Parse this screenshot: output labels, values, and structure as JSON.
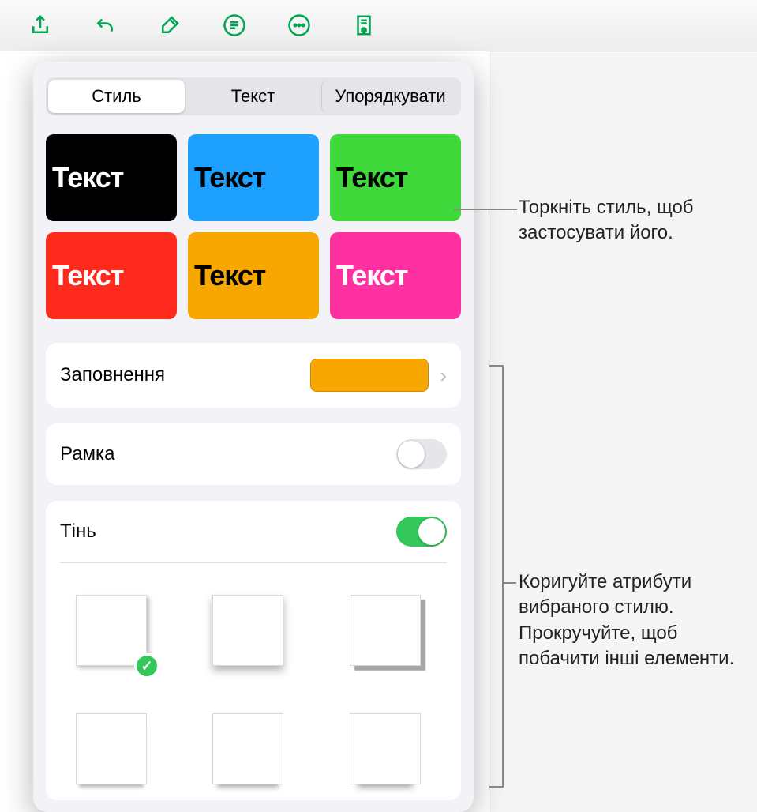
{
  "toolbar_icons": [
    "share-icon",
    "undo-icon",
    "paintbrush-icon",
    "paragraph-icon",
    "more-icon",
    "read-icon"
  ],
  "tabs": {
    "style": "Стиль",
    "text": "Текст",
    "arrange": "Упорядкувати"
  },
  "active_tab": "Стиль",
  "style_presets": [
    {
      "bg": "#000000",
      "fg": "#ffffff",
      "label": "Текст"
    },
    {
      "bg": "#1ea0ff",
      "fg": "#000000",
      "label": "Текст"
    },
    {
      "bg": "#3fd93c",
      "fg": "#000000",
      "label": "Текст"
    },
    {
      "bg": "#fe2a1e",
      "fg": "#ffffff",
      "label": "Текст"
    },
    {
      "bg": "#f7a700",
      "fg": "#000000",
      "label": "Текст"
    },
    {
      "bg": "#ff30a0",
      "fg": "#ffffff",
      "label": "Текст"
    }
  ],
  "fill": {
    "label": "Заповнення",
    "color": "#f7a700"
  },
  "border": {
    "label": "Рамка",
    "enabled": false
  },
  "shadow": {
    "label": "Тінь",
    "enabled": true,
    "options": [
      {
        "shadow_css": "3px 3px 5px rgba(0,0,0,0.25)",
        "selected": true
      },
      {
        "shadow_css": "0 6px 10px rgba(0,0,0,0.3)",
        "selected": false
      },
      {
        "shadow_css": "6px 6px 1px rgba(0,0,0,0.35)",
        "selected": false
      },
      {
        "shadow_css": "0 8px 4px -4px rgba(0,0,0,0.25)",
        "selected": false
      },
      {
        "shadow_css": "0 10px 6px -6px rgba(0,0,0,0.3)",
        "selected": false
      },
      {
        "shadow_css": "0 14px 8px -10px rgba(0,0,0,0.35)",
        "selected": false
      }
    ]
  },
  "callouts": {
    "tap_style": "Торкніть стиль, щоб застосувати його.",
    "adjust_attrs": "Коригуйте атрибути вибраного стилю. Прокручуйте, щоб побачити інші елементи."
  }
}
